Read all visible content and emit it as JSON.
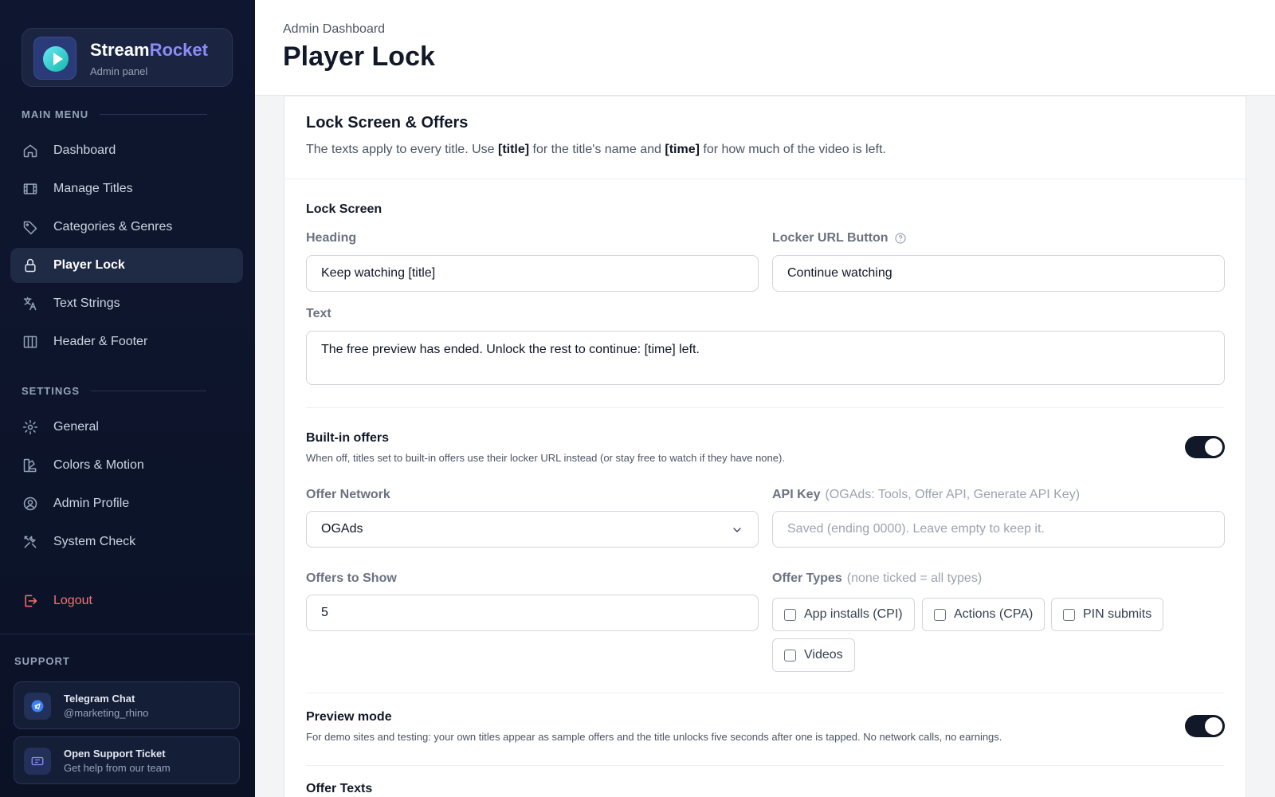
{
  "brand": {
    "name_main": "Stream",
    "name_accent": "Rocket",
    "subtitle": "Admin panel"
  },
  "sidebar": {
    "main_menu_label": "MAIN MENU",
    "settings_label": "SETTINGS",
    "support_label": "SUPPORT",
    "main_items": [
      {
        "label": "Dashboard",
        "icon": "home-icon"
      },
      {
        "label": "Manage Titles",
        "icon": "film-icon"
      },
      {
        "label": "Categories & Genres",
        "icon": "tag-icon"
      },
      {
        "label": "Player Lock",
        "icon": "lock-icon",
        "active": true
      },
      {
        "label": "Text Strings",
        "icon": "translate-icon"
      },
      {
        "label": "Header & Footer",
        "icon": "columns-icon"
      }
    ],
    "settings_items": [
      {
        "label": "General",
        "icon": "gear-icon"
      },
      {
        "label": "Colors & Motion",
        "icon": "palette-icon"
      },
      {
        "label": "Admin Profile",
        "icon": "user-circle-icon"
      },
      {
        "label": "System Check",
        "icon": "tools-icon"
      }
    ],
    "logout_label": "Logout",
    "support": [
      {
        "title": "Telegram Chat",
        "subtitle": "@marketing_rhino",
        "icon": "telegram-icon"
      },
      {
        "title": "Open Support Ticket",
        "subtitle": "Get help from our team",
        "icon": "ticket-icon"
      }
    ]
  },
  "header": {
    "breadcrumb": "Admin Dashboard",
    "title": "Player Lock"
  },
  "card": {
    "title": "Lock Screen & Offers",
    "desc_parts": [
      "The texts apply to every title. Use ",
      "[title]",
      " for the title's name and ",
      "[time]",
      " for how much of the video is left."
    ]
  },
  "lock_screen": {
    "group_title": "Lock Screen",
    "heading_label": "Heading",
    "heading_value": "Keep watching [title]",
    "locker_label": "Locker URL Button",
    "locker_value": "Continue watching",
    "text_label": "Text",
    "text_value": "The free preview has ended. Unlock the rest to continue: [time] left."
  },
  "builtin_offers": {
    "title": "Built-in offers",
    "desc": "When off, titles set to built-in offers use their locker URL instead (or stay free to watch if they have none).",
    "enabled": true
  },
  "offer_network": {
    "label": "Offer Network",
    "value": "OGAds"
  },
  "api_key": {
    "label": "API Key",
    "hint": "(OGAds: Tools, Offer API, Generate API Key)",
    "placeholder": "Saved (ending 0000). Leave empty to keep it."
  },
  "offers_to_show": {
    "label": "Offers to Show",
    "value": "5"
  },
  "offer_types": {
    "label": "Offer Types",
    "hint": "(none ticked = all types)",
    "options": [
      {
        "label": "App installs (CPI)",
        "checked": false
      },
      {
        "label": "Actions (CPA)",
        "checked": false
      },
      {
        "label": "PIN submits",
        "checked": false
      },
      {
        "label": "Videos",
        "checked": false
      }
    ]
  },
  "preview_mode": {
    "title": "Preview mode",
    "desc": "For demo sites and testing: your own titles appear as sample offers and the title unlocks five seconds after one is tapped. No network calls, no earnings.",
    "enabled": true
  },
  "offer_texts": {
    "title": "Offer Texts"
  },
  "colors": {
    "accent": "#8b8cf8",
    "sidebar_bg": "#0f1730",
    "logout": "#f87171",
    "toggle_on": "#111827"
  }
}
